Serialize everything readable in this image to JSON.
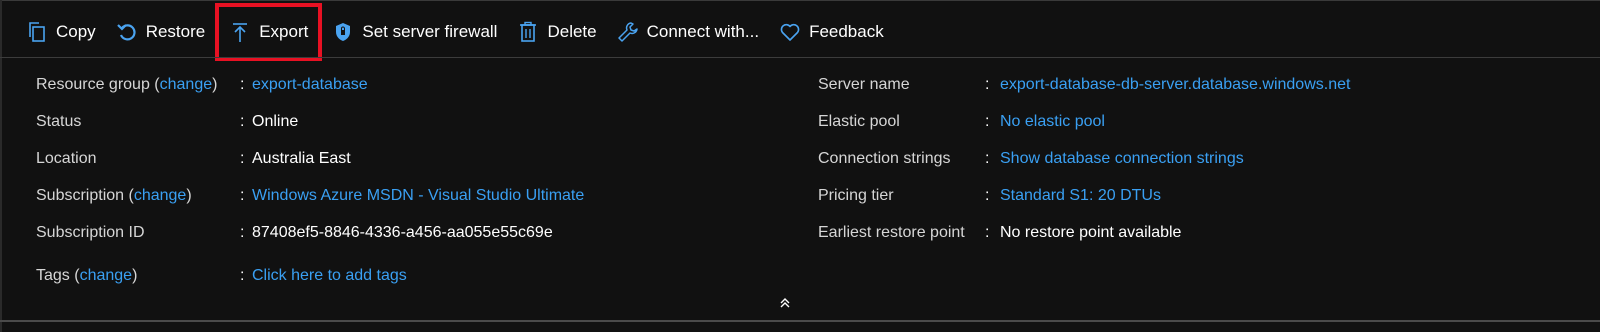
{
  "toolbar": {
    "copy_label": "Copy",
    "restore_label": "Restore",
    "export_label": "Export",
    "firewall_label": "Set server firewall",
    "delete_label": "Delete",
    "connect_label": "Connect with...",
    "feedback_label": "Feedback"
  },
  "highlight_color": "#e81123",
  "link_color": "#3aa0f3",
  "left": {
    "resource_group": {
      "label": "Resource group",
      "open": "(",
      "change": "change",
      "close": ")",
      "value": "export-database"
    },
    "status": {
      "label": "Status",
      "value": "Online"
    },
    "location": {
      "label": "Location",
      "value": "Australia East"
    },
    "subscription": {
      "label": "Subscription",
      "open": "(",
      "change": "change",
      "close": ")",
      "value": "Windows Azure MSDN - Visual Studio Ultimate"
    },
    "subscription_id": {
      "label": "Subscription ID",
      "value": "87408ef5-8846-4336-a456-aa055e55c69e"
    },
    "tags": {
      "label": "Tags",
      "open": "(",
      "change": "change",
      "close": ")",
      "value": "Click here to add tags"
    }
  },
  "right": {
    "server_name": {
      "label": "Server name",
      "value": "export-database-db-server.database.windows.net"
    },
    "elastic_pool": {
      "label": "Elastic pool",
      "value": "No elastic pool"
    },
    "connection_strings": {
      "label": "Connection strings",
      "value": "Show database connection strings"
    },
    "pricing_tier": {
      "label": "Pricing tier",
      "value": "Standard S1: 20 DTUs"
    },
    "earliest_restore": {
      "label": "Earliest restore point",
      "value": "No restore point available"
    }
  },
  "colon": ":",
  "icons": [
    "copy-icon",
    "restore-icon",
    "export-icon",
    "shield-icon",
    "trash-icon",
    "wrench-icon",
    "heart-icon",
    "double-chevron-up-icon"
  ]
}
